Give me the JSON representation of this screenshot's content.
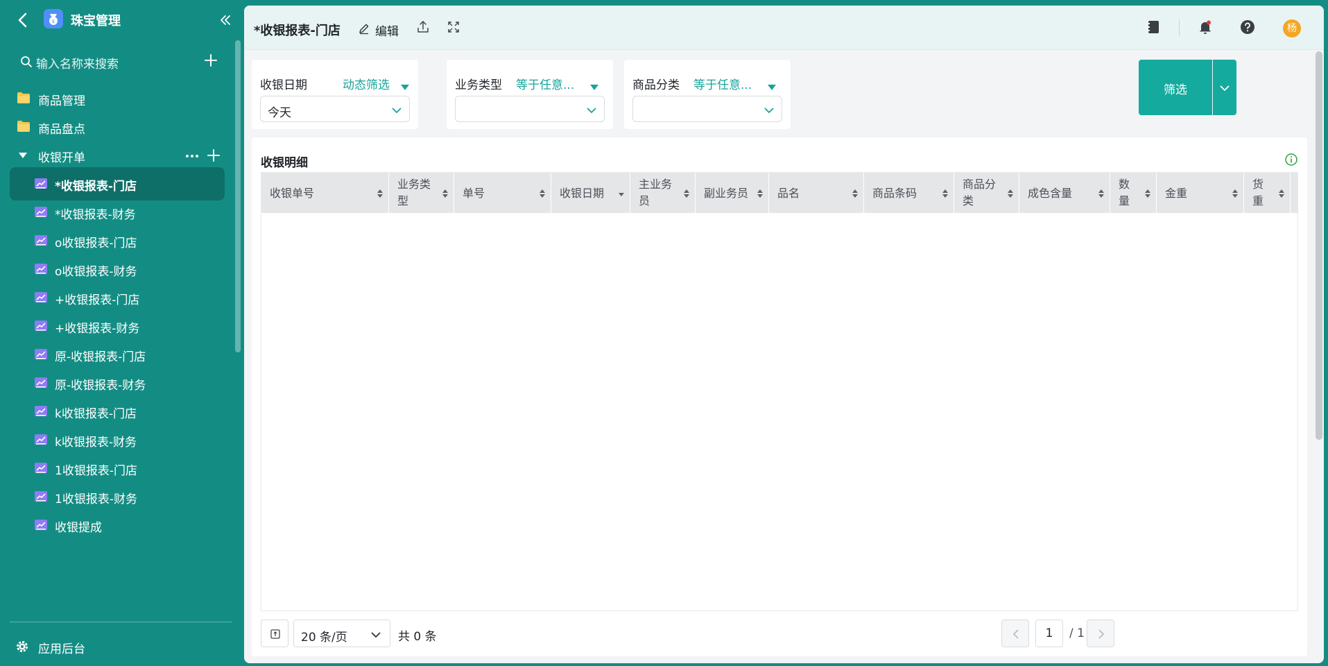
{
  "app": {
    "name": "珠宝管理"
  },
  "sidebar": {
    "search_placeholder": "输入名称来搜索",
    "folders": [
      {
        "label": "商品管理",
        "icon": "folder-icon"
      },
      {
        "label": "商品盘点",
        "icon": "folder-icon"
      }
    ],
    "group": {
      "label": "收银开单",
      "expanded": true
    },
    "items": [
      {
        "label": "*收银报表-门店",
        "active": true
      },
      {
        "label": "*收银报表-财务"
      },
      {
        "label": "o收银报表-门店"
      },
      {
        "label": "o收银报表-财务"
      },
      {
        "label": "+收银报表-门店"
      },
      {
        "label": "+收银报表-财务"
      },
      {
        "label": "原-收银报表-门店"
      },
      {
        "label": "原-收银报表-财务"
      },
      {
        "label": "k收银报表-门店"
      },
      {
        "label": "k收银报表-财务"
      },
      {
        "label": "1收银报表-门店"
      },
      {
        "label": "1收银报表-财务"
      },
      {
        "label": "收银提成"
      }
    ],
    "footer_label": "应用后台"
  },
  "header": {
    "title": "*收银报表-门店",
    "edit_label": "编辑",
    "avatar_text": "杨"
  },
  "filters": [
    {
      "label": "收银日期",
      "mode": "动态筛选",
      "value": "今天"
    },
    {
      "label": "业务类型",
      "mode": "等于任意...",
      "value": ""
    },
    {
      "label": "商品分类",
      "mode": "等于任意...",
      "value": ""
    }
  ],
  "filter_button": {
    "label": "筛选"
  },
  "panel": {
    "title": "收银明细",
    "columns": [
      "收银单号",
      "业务类型",
      "单号",
      "收银日期",
      "主业务员",
      "副业务员",
      "品名",
      "商品条码",
      "商品分类",
      "成色含量",
      "数量",
      "金重",
      "货重"
    ],
    "rows": []
  },
  "pagination": {
    "page_size": "20 条/页",
    "total": "共 0 条",
    "current_page": "1",
    "total_pages": "/ 1"
  },
  "colors": {
    "sidebar_bg": "#138d84",
    "sidebar_active": "#0e6f68",
    "accent": "#14aa9e",
    "accent_text": "#16a49a"
  }
}
